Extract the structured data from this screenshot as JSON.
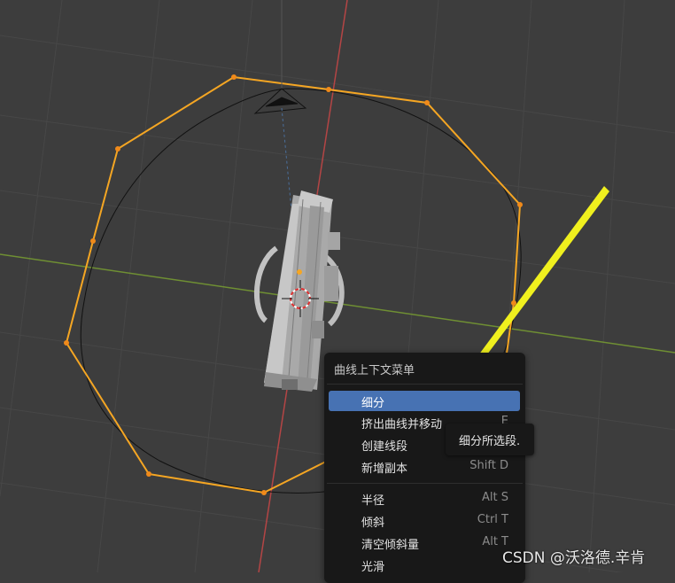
{
  "context_menu": {
    "title": "曲线上下文菜单",
    "items": [
      {
        "label": "细分",
        "shortcut": "",
        "active": true
      },
      {
        "label": "挤出曲线并移动",
        "shortcut": "E",
        "active": false
      },
      {
        "label": "创建线段",
        "shortcut": "",
        "active": false
      },
      {
        "label": "新增副本",
        "shortcut": "Shift D",
        "active": false
      },
      {
        "label": "半径",
        "shortcut": "Alt S",
        "active": false
      },
      {
        "label": "倾斜",
        "shortcut": "Ctrl T",
        "active": false
      },
      {
        "label": "清空倾斜量",
        "shortcut": "Alt T",
        "active": false
      },
      {
        "label": "光滑",
        "shortcut": "",
        "active": false
      }
    ]
  },
  "tooltip": {
    "text": "细分所选段."
  },
  "watermark": {
    "text": "CSDN @沃洛德.辛肯"
  },
  "colors": {
    "background": "#3d3d3d",
    "selection": "#f5a623",
    "x_axis": "#c24a4a",
    "y_axis": "#7a9a3a",
    "menu_highlight": "#4772b3",
    "annotation_arrow": "#f0f01e"
  },
  "icons": [
    "annotation-arrow-icon",
    "object-origin-icon",
    "3d-cursor-icon",
    "camera-icon"
  ]
}
